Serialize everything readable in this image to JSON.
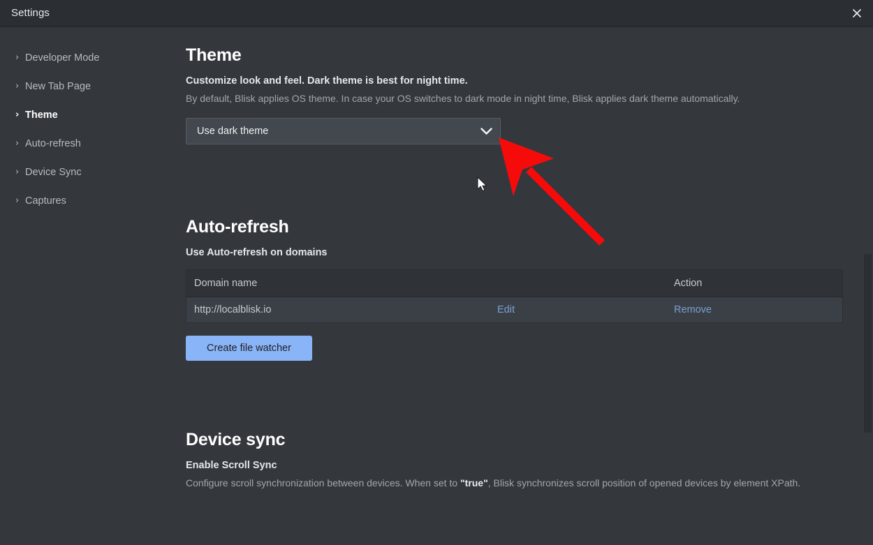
{
  "window": {
    "title": "Settings",
    "close_icon": "close-icon"
  },
  "sidebar": {
    "items": [
      {
        "label": "Developer Mode",
        "icon": "chevron-right-icon",
        "active": false
      },
      {
        "label": "New Tab Page",
        "icon": "chevron-right-icon",
        "active": false
      },
      {
        "label": "Theme",
        "icon": "chevron-right-icon",
        "active": true
      },
      {
        "label": "Auto-refresh",
        "icon": "chevron-right-icon",
        "active": false
      },
      {
        "label": "Device Sync",
        "icon": "chevron-right-icon",
        "active": false
      },
      {
        "label": "Captures",
        "icon": "chevron-right-icon",
        "active": false
      }
    ]
  },
  "theme_section": {
    "title": "Theme",
    "subtitle": "Customize look and feel. Dark theme is best for night time.",
    "description": "By default, Blisk applies OS theme. In case your OS switches to dark mode in night time, Blisk applies dark theme automatically.",
    "select": {
      "value": "Use dark theme",
      "caret_icon": "chevron-down-icon"
    }
  },
  "autorefresh_section": {
    "title": "Auto-refresh",
    "subtitle": "Use Auto-refresh on domains",
    "table": {
      "headers": [
        "Domain name",
        "",
        "Action"
      ],
      "rows": [
        {
          "domain": "http://localblisk.io",
          "edit": "Edit",
          "remove": "Remove"
        }
      ]
    },
    "create_button": "Create file watcher"
  },
  "devicesync_section": {
    "title": "Device sync",
    "subtitle": "Enable Scroll Sync",
    "description_part1": "Configure scroll synchronization between devices. When set to ",
    "description_bold": "\"true\"",
    "description_part2": ", Blisk synchronizes scroll position of opened devices by element XPath."
  },
  "annotation": {
    "arrow_color": "#f60b0b",
    "arrow_tip": "715,198",
    "arrow_tail": "862,348"
  },
  "colors": {
    "background": "#34383d",
    "titlebar": "#2b2f34",
    "accent_button": "#8ab4f8",
    "link": "#7d9fd2",
    "text_primary": "#ffffff",
    "text_secondary": "#a2a7ac"
  }
}
